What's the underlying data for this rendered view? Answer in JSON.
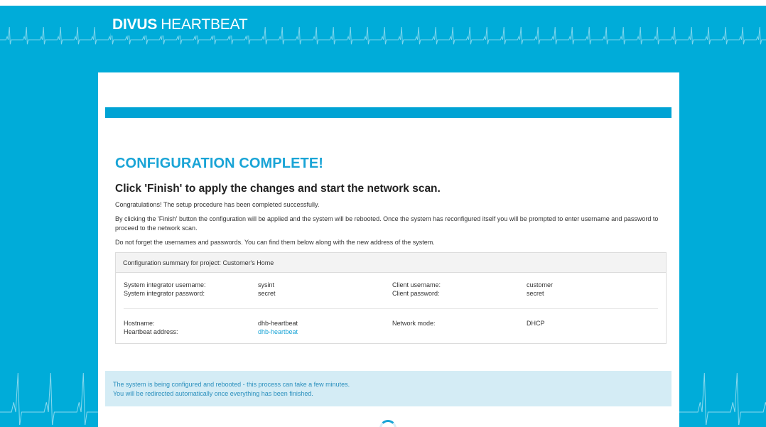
{
  "header": {
    "brand_primary": "DIVUS",
    "brand_secondary": "HEARTBEAT"
  },
  "main": {
    "title": "CONFIGURATION COMPLETE!",
    "subtitle": "Click 'Finish' to apply the changes and start the network scan.",
    "paragraphs": [
      "Congratulations! The setup procedure has been completed successfully.",
      "By clicking the 'Finish' button the configuration will be applied and the system will be rebooted. Once the system has reconfigured itself you will be prompted to enter username and password to proceed to the network scan.",
      "Do not forget the usernames and passwords. You can find them below along with the new address of the system."
    ]
  },
  "summary": {
    "header": "Configuration summary for project: Customer's Home",
    "si_username_label": "System integrator username:",
    "si_username": "sysint",
    "si_password_label": "System integrator password:",
    "si_password": "secret",
    "client_username_label": "Client username:",
    "client_username": "customer",
    "client_password_label": "Client password:",
    "client_password": "secret",
    "hostname_label": "Hostname:",
    "hostname": "dhb-heartbeat",
    "heartbeat_address_label": "Heartbeat address:",
    "heartbeat_address": "dhb-heartbeat",
    "network_mode_label": "Network mode:",
    "network_mode": "DHCP"
  },
  "status": {
    "line1": "The system is being configured and rebooted - this process can take a few minutes.",
    "line2": "You will be redirected automatically once everything has been finished."
  },
  "colors": {
    "background": "#00acd9",
    "accent": "#19a4d6",
    "status_bg": "#d4ecf5"
  },
  "icons": {
    "spinner": "loading-spinner-icon",
    "heartbeat_pattern": "heartbeat-line-icon"
  }
}
